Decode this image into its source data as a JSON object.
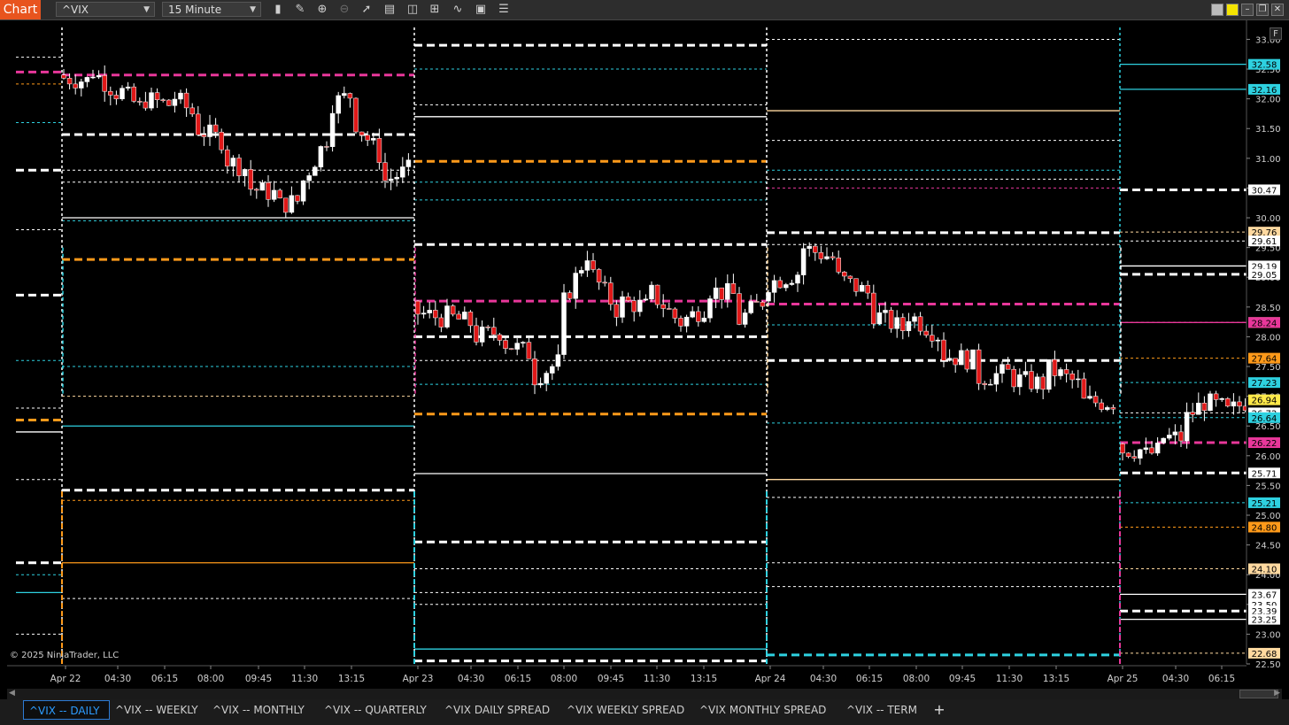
{
  "toolbar": {
    "chart_label": "Chart",
    "instrument": "^VIX",
    "interval": "15 Minute",
    "tools": [
      "bar-style-icon",
      "pencil-icon",
      "zoom-in-icon",
      "zoom-out-icon",
      "pointer-icon",
      "properties-icon",
      "data-series-icon",
      "strategies-icon",
      "indicators-icon",
      "templates-icon",
      "list-icon"
    ]
  },
  "copyright": "© 2025 NinjaTrader, LLC",
  "f_button": "F",
  "tabs": [
    {
      "label": "^VIX -- DAILY",
      "active": true
    },
    {
      "label": "^VIX -- WEEKLY",
      "active": false
    },
    {
      "label": "^VIX -- MONTHLY",
      "active": false
    },
    {
      "label": "^VIX -- QUARTERLY",
      "active": false
    },
    {
      "label": "^VIX DAILY SPREAD",
      "active": false
    },
    {
      "label": "^VIX WEEKLY SPREAD",
      "active": false
    },
    {
      "label": "^VIX MONTHLY SPREAD",
      "active": false
    },
    {
      "label": "^VIX -- TERM",
      "active": false
    }
  ],
  "chart_data": {
    "type": "candlestick",
    "instrument": "^VIX",
    "interval": "15 Minute",
    "ylim": [
      22.5,
      33.2
    ],
    "y_ticks": [
      "33.00",
      "32.50",
      "32.00",
      "31.50",
      "31.00",
      "30.50",
      "30.00",
      "29.50",
      "29.00",
      "28.50",
      "28.00",
      "27.50",
      "27.00",
      "26.50",
      "26.00",
      "25.50",
      "25.00",
      "24.50",
      "24.00",
      "23.50",
      "23.00",
      "22.50"
    ],
    "x_ticks": [
      "Apr 22",
      "04:30",
      "06:15",
      "08:00",
      "09:45",
      "11:30",
      "13:15",
      "Apr 23",
      "04:30",
      "06:15",
      "08:00",
      "09:45",
      "11:30",
      "13:15",
      "Apr 24",
      "04:30",
      "06:15",
      "08:00",
      "09:45",
      "11:30",
      "13:15",
      "Apr 25",
      "04:30",
      "06:15"
    ],
    "price_markers": [
      {
        "label": "32.58",
        "color": "#2ed1e0"
      },
      {
        "label": "32.16",
        "color": "#2ed1e0"
      },
      {
        "label": "30.47",
        "color": "#ffffff"
      },
      {
        "label": "29.76",
        "color": "#ffd9a0"
      },
      {
        "label": "29.61",
        "color": "#ffffff"
      },
      {
        "label": "29.19",
        "color": "#ffffff"
      },
      {
        "label": "29.05",
        "color": "#ffffff"
      },
      {
        "label": "28.24",
        "color": "#ffd9a0"
      },
      {
        "label": "28.24",
        "color": "#e8379a"
      },
      {
        "label": "27.64",
        "color": "#ff9a1a"
      },
      {
        "label": "27.23",
        "color": "#2ed1e0"
      },
      {
        "label": "26.94",
        "color": "#ffe94a"
      },
      {
        "label": "26.72",
        "color": "#ffffff"
      },
      {
        "label": "26.64",
        "color": "#2ed1e0"
      },
      {
        "label": "26.22",
        "color": "#e8379a"
      },
      {
        "label": "25.71",
        "color": "#ffffff"
      },
      {
        "label": "25.21",
        "color": "#2ed1e0"
      },
      {
        "label": "24.80",
        "color": "#ff9a1a"
      },
      {
        "label": "24.10",
        "color": "#ffd9a0"
      },
      {
        "label": "23.67",
        "color": "#ffffff"
      },
      {
        "label": "23.50",
        "color": "#ffffff"
      },
      {
        "label": "23.39",
        "color": "#ffffff"
      },
      {
        "label": "23.25",
        "color": "#ffffff"
      },
      {
        "label": "22.68",
        "color": "#ffd9a0"
      }
    ],
    "days": [
      {
        "label": "Apr 22",
        "path": [
          [
            32.4,
            32.35
          ],
          [
            32.3,
            32.5
          ],
          [
            32.1,
            32.2
          ],
          [
            31.8,
            32.0
          ],
          [
            31.9,
            32.1
          ],
          [
            31.7,
            31.5
          ],
          [
            31.3,
            31.0
          ],
          [
            30.8,
            30.5
          ],
          [
            30.4,
            30.2
          ],
          [
            30.3,
            30.6
          ],
          [
            31.4,
            31.9
          ],
          [
            32.1,
            31.6
          ],
          [
            31.0,
            30.6
          ],
          [
            30.8,
            30.7
          ]
        ]
      },
      {
        "label": "Apr 23",
        "path": [
          [
            28.6,
            28.4
          ],
          [
            28.3,
            28.35
          ],
          [
            28.2,
            28.0
          ],
          [
            28.1,
            27.9
          ],
          [
            27.7,
            27.3
          ],
          [
            27.6,
            28.5
          ],
          [
            29.5,
            29.1
          ],
          [
            28.4,
            28.6
          ],
          [
            28.5,
            28.8
          ],
          [
            28.3,
            28.2
          ],
          [
            28.5,
            28.8
          ],
          [
            28.7,
            28.2
          ],
          [
            28.6,
            28.8
          ]
        ]
      },
      {
        "label": "Apr 24",
        "path": [
          [
            28.6,
            28.9
          ],
          [
            29.1,
            29.5
          ],
          [
            29.3,
            29.0
          ],
          [
            28.7,
            28.4
          ],
          [
            28.1,
            28.4
          ],
          [
            28.0,
            27.7
          ],
          [
            27.6,
            27.3
          ],
          [
            27.4,
            27.3
          ],
          [
            27.2,
            27.5
          ],
          [
            27.2,
            26.9
          ],
          [
            26.9,
            26.6
          ]
        ]
      },
      {
        "label": "Apr 25",
        "path": [
          [
            26.2,
            26.1
          ],
          [
            26.1,
            26.0
          ],
          [
            26.1,
            26.3
          ],
          [
            26.3,
            26.6
          ],
          [
            26.9,
            26.9
          ],
          [
            26.8,
            26.7
          ],
          [
            26.9,
            27.0
          ]
        ]
      }
    ]
  }
}
